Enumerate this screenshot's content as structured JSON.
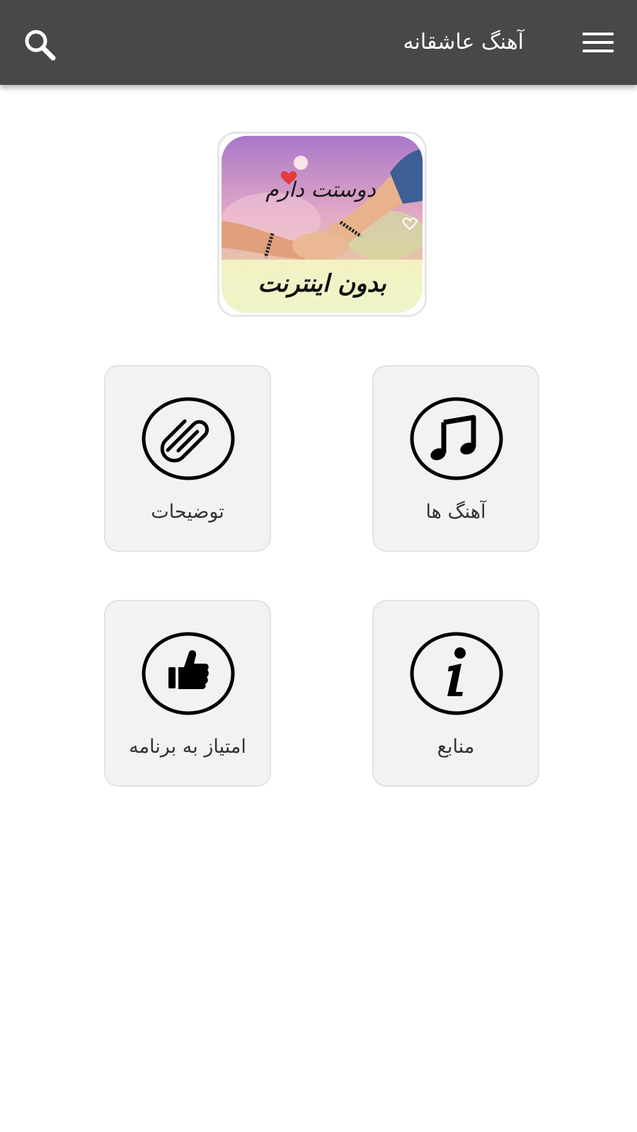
{
  "appbar": {
    "title": "آهنگ عاشقانه",
    "menu_icon": "hamburger-menu-icon",
    "search_icon": "search-icon",
    "background_color": "#484848"
  },
  "banner": {
    "script_text": "دوستت دارم",
    "caption": "بدون اینترنت"
  },
  "tiles": [
    {
      "label": "آهنگ ها",
      "icon": "music-note-icon"
    },
    {
      "label": "توضیحات",
      "icon": "paperclip-icon"
    },
    {
      "label": "منابع",
      "icon": "info-icon"
    },
    {
      "label": "امتیاز به برنامه",
      "icon": "thumbs-up-icon"
    }
  ],
  "colors": {
    "tile_background": "#f2f2f2",
    "tile_border": "#e2e2e2",
    "text": "#333333"
  }
}
